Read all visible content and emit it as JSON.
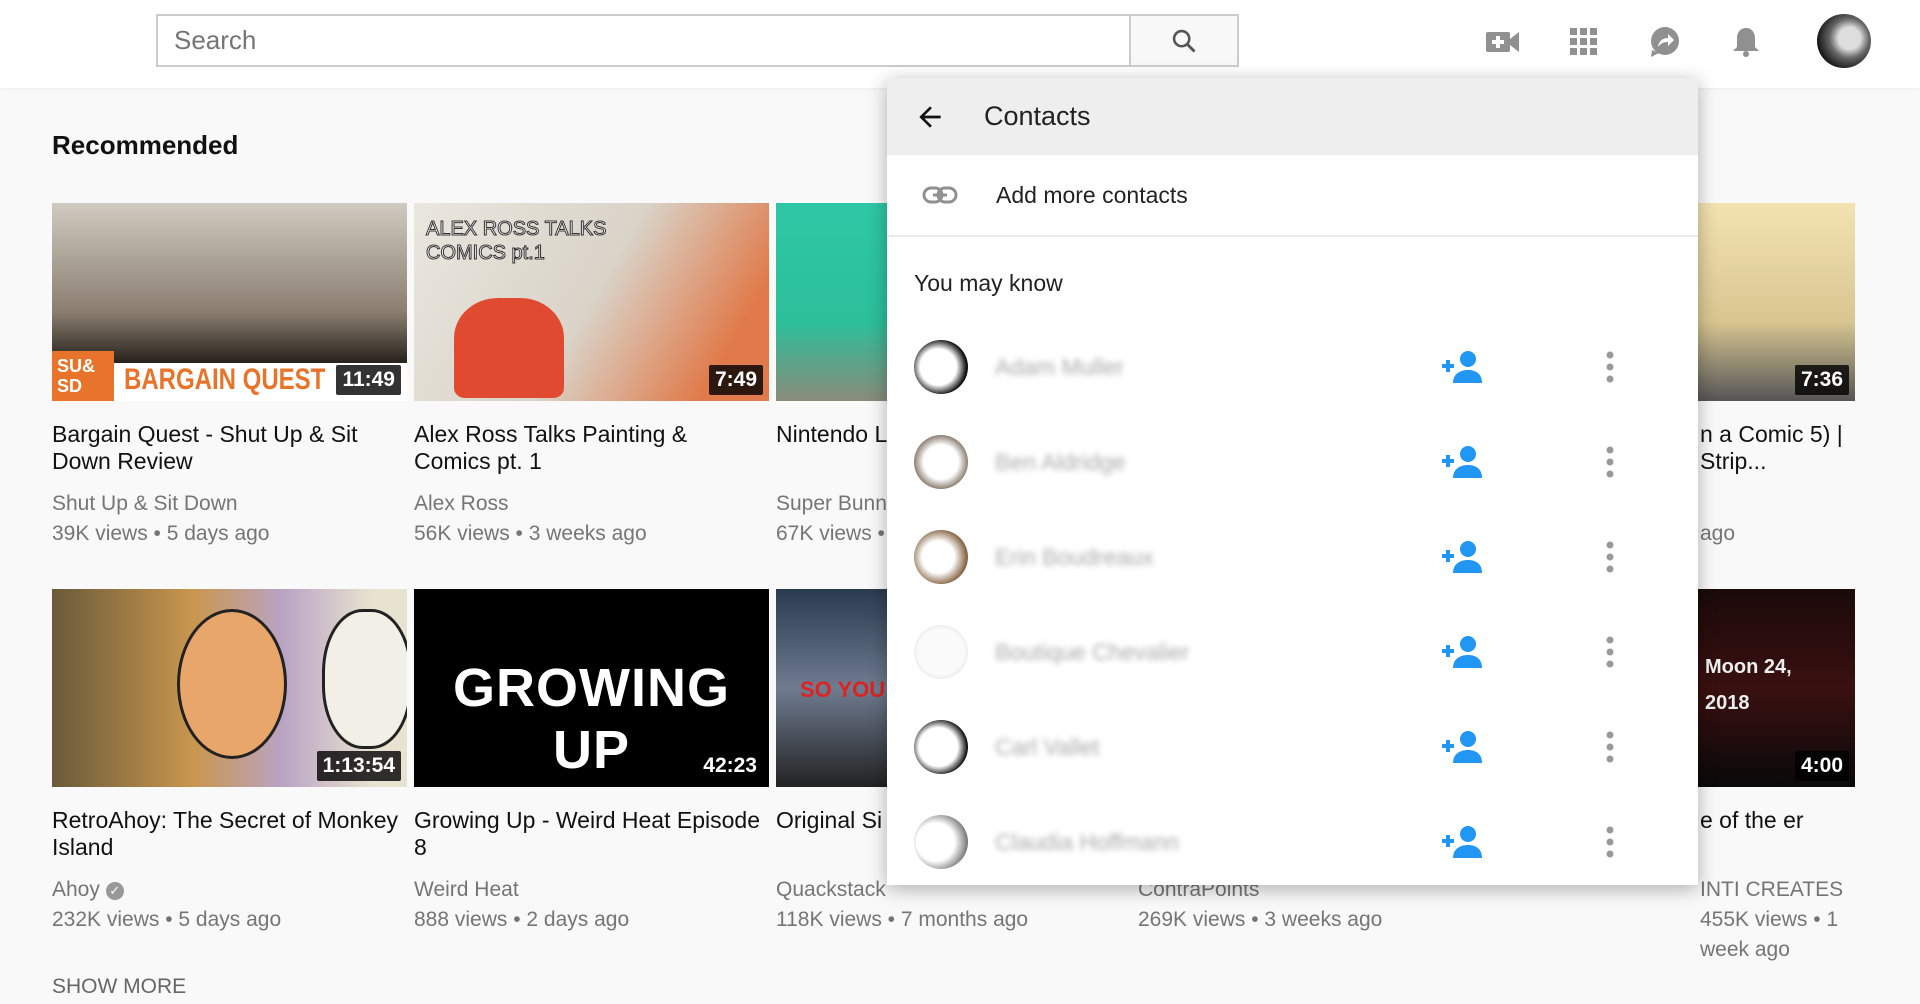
{
  "header": {
    "search_placeholder": "Search",
    "icons": [
      "create-video-icon",
      "apps-icon",
      "share-icon",
      "notifications-icon"
    ]
  },
  "section_title": "Recommended",
  "show_more": "SHOW MORE",
  "videos": [
    {
      "title": "Bargain Quest - Shut Up & Sit Down Review",
      "channel": "Shut Up & Sit Down",
      "meta": "39K views • 5 days ago",
      "duration": "11:49",
      "thumb_text": "BARGAIN QUEST",
      "thumb_badge": "SU& SD"
    },
    {
      "title": "Alex Ross Talks Painting & Comics pt. 1",
      "channel": "Alex Ross",
      "meta": "56K views • 3 weeks ago",
      "duration": "7:49",
      "thumb_text": "ALEX ROSS TALKS COMICS pt.1"
    },
    {
      "title": "Nintendo L of Edutainn",
      "channel": "Super Bunn",
      "meta": "67K views •"
    },
    {
      "title": "",
      "channel": "",
      "meta": ""
    },
    {
      "title": "n a Comic 5) | Strip...",
      "channel": "",
      "meta": "ago",
      "duration": "7:36"
    },
    {
      "title": "RetroAhoy: The Secret of Monkey Island",
      "channel": "Ahoy",
      "verified": true,
      "meta": "232K views • 5 days ago",
      "duration": "1:13:54"
    },
    {
      "title": "Growing Up - Weird Heat Episode 8",
      "channel": "Weird Heat",
      "meta": "888 views • 2 days ago",
      "duration": "42:23",
      "thumb_text": "GROWING UP"
    },
    {
      "title": "Original Si To Be A Su",
      "channel": "Quackstack",
      "meta": "118K views • 7 months ago",
      "thumb_text": "SO YOU W"
    },
    {
      "title": "",
      "channel": "ContraPoints",
      "meta": "269K views • 3 weeks ago"
    },
    {
      "title": "e of the er",
      "channel": "INTI CREATES",
      "meta": "455K views • 1 week ago",
      "duration": "4:00",
      "thumb_text": "Moon 24, 2018"
    }
  ],
  "contacts_panel": {
    "title": "Contacts",
    "add_more": "Add more contacts",
    "section": "You may know",
    "contacts": [
      {
        "name": "Adam Muller"
      },
      {
        "name": "Ben Aldridge"
      },
      {
        "name": "Erin Boudreaux"
      },
      {
        "name": "Boutique Chevalier"
      },
      {
        "name": "Carl Vallet"
      },
      {
        "name": "Claudia Hoffmann"
      }
    ],
    "accent": "#2196f3"
  }
}
